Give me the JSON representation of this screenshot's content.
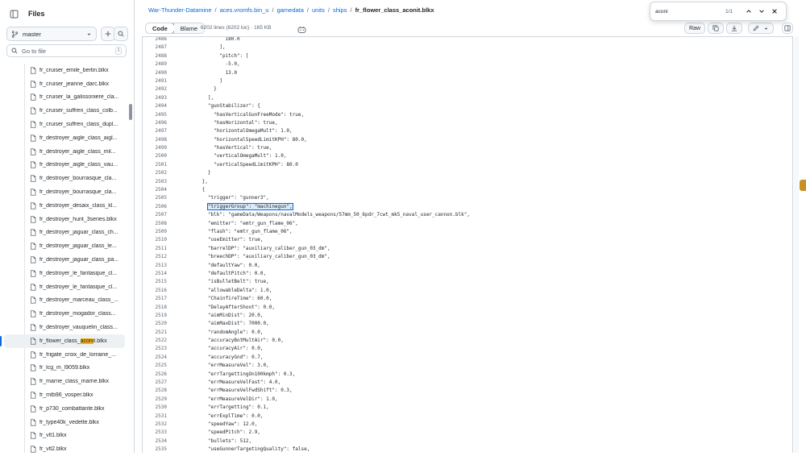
{
  "sidebar": {
    "title": "Files",
    "branch": "master",
    "goto_placeholder": "Go to file",
    "goto_shortcut": "t",
    "items": [
      {
        "label": "fr_cruiser_emile_bertin.blkx"
      },
      {
        "label": "fr_cruiser_jeanne_darc.blkx"
      },
      {
        "label": "fr_cruiser_la_galissoniere_cla..."
      },
      {
        "label": "fr_cruiser_suffren_class_colb..."
      },
      {
        "label": "fr_cruiser_suffren_class_dupl..."
      },
      {
        "label": "fr_destroyer_aigle_class_aigl..."
      },
      {
        "label": "fr_destroyer_aigle_class_mil..."
      },
      {
        "label": "fr_destroyer_aigle_class_vau..."
      },
      {
        "label": "fr_destroyer_bourrasque_cla..."
      },
      {
        "label": "fr_destroyer_bourrasque_cla..."
      },
      {
        "label": "fr_destroyer_desaix_class_kl..."
      },
      {
        "label": "fr_destroyer_hunt_3series.blkx"
      },
      {
        "label": "fr_destroyer_jaguar_class_ch..."
      },
      {
        "label": "fr_destroyer_jaguar_class_le..."
      },
      {
        "label": "fr_destroyer_jaguar_class_pa..."
      },
      {
        "label": "fr_destroyer_le_fantasque_cl..."
      },
      {
        "label": "fr_destroyer_le_fantasque_cl..."
      },
      {
        "label": "fr_destroyer_marceau_class_..."
      },
      {
        "label": "fr_destroyer_mogador_class..."
      },
      {
        "label": "fr_destroyer_vauquelin_class..."
      },
      {
        "label": "fr_flower_class_aconit.blkx",
        "pre": "fr_flower_class_",
        "hl": "aconi",
        "post": "t.blkx",
        "selected": true
      },
      {
        "label": "fr_frigate_croix_de_lorraine_..."
      },
      {
        "label": "fr_lcg_m_l9059.blkx"
      },
      {
        "label": "fr_marne_class_marne.blkx"
      },
      {
        "label": "fr_mtb96_vosper.blkx"
      },
      {
        "label": "fr_p730_combattante.blkx"
      },
      {
        "label": "fr_type40k_vedette.blkx"
      },
      {
        "label": "fr_vlt1.blkx"
      },
      {
        "label": "fr_vlt2.blkx"
      }
    ]
  },
  "breadcrumbs": {
    "repo": "War-Thunder-Datamine",
    "parts": [
      "aces.vromfs.bin_u",
      "gamedata",
      "units",
      "ships"
    ],
    "current": "fr_flower_class_aconit.blkx"
  },
  "toolbar": {
    "code_label": "Code",
    "blame_label": "Blame",
    "meta": "6202 lines (6202 loc) · 165 KB",
    "raw_label": "Raw"
  },
  "find": {
    "query": "aconi",
    "count": "1/1"
  },
  "code": {
    "lines": [
      {
        "n": "2486",
        "t": "              180.0"
      },
      {
        "n": "2487",
        "t": "            ],"
      },
      {
        "n": "2488",
        "t": "            \"pitch\": ["
      },
      {
        "n": "2489",
        "t": "              -5.0,"
      },
      {
        "n": "2490",
        "t": "              13.0"
      },
      {
        "n": "2491",
        "t": "            ]"
      },
      {
        "n": "2492",
        "t": "          }"
      },
      {
        "n": "2493",
        "t": "        ],"
      },
      {
        "n": "2494",
        "t": "        \"gunStabilizer\": {"
      },
      {
        "n": "2495",
        "t": "          \"hasVerticalGunFreeMode\": true,"
      },
      {
        "n": "2496",
        "t": "          \"hasHorizontal\": true,"
      },
      {
        "n": "2497",
        "t": "          \"horizontalOmegaMult\": 1.0,"
      },
      {
        "n": "2498",
        "t": "          \"horizontalSpeedLimitKPH\": 80.0,"
      },
      {
        "n": "2499",
        "t": "          \"hasVertical\": true,"
      },
      {
        "n": "2500",
        "t": "          \"verticalOmegaMult\": 1.0,"
      },
      {
        "n": "2501",
        "t": "          \"verticalSpeedLimitKPH\": 80.0"
      },
      {
        "n": "2502",
        "t": "        }"
      },
      {
        "n": "2503",
        "t": "      },"
      },
      {
        "n": "2504",
        "t": "      {"
      },
      {
        "n": "2505",
        "t": "        \"trigger\": \"gunner3\","
      },
      {
        "n": "2506",
        "t": "        \"triggerGroup\": \"machinegun\",",
        "cur": true
      },
      {
        "n": "2507",
        "t": "        \"blk\": \"gameData/Weapons/navalModels_weapons/57mm_50_6pdr_7cwt_mk5_naval_user_cannon.blk\","
      },
      {
        "n": "2508",
        "t": "        \"emitter\": \"emtr_gun_flame_06\","
      },
      {
        "n": "2509",
        "t": "        \"flash\": \"emtr_gun_flame_06\","
      },
      {
        "n": "2510",
        "t": "        \"useEmitter\": true,"
      },
      {
        "n": "2511",
        "t": "        \"barrelDP\": \"auxiliary_caliber_gun_03_dm\","
      },
      {
        "n": "2512",
        "t": "        \"breechDP\": \"auxiliary_caliber_gun_03_dm\","
      },
      {
        "n": "2513",
        "t": "        \"defaultYaw\": 0.0,"
      },
      {
        "n": "2514",
        "t": "        \"defaultPitch\": 0.0,"
      },
      {
        "n": "2515",
        "t": "        \"isBulletBelt\": true,"
      },
      {
        "n": "2516",
        "t": "        \"allowableDelta\": 1.0,"
      },
      {
        "n": "2517",
        "t": "        \"ChainfireTime\": 60.0,"
      },
      {
        "n": "2518",
        "t": "        \"DelayAfterShoot\": 0.0,"
      },
      {
        "n": "2519",
        "t": "        \"aimMinDist\": 20.0,"
      },
      {
        "n": "2520",
        "t": "        \"aimMaxDist\": 7000.0,"
      },
      {
        "n": "2521",
        "t": "        \"randomAngle\": 0.0,"
      },
      {
        "n": "2522",
        "t": "        \"accuracyBotMultAir\": 0.0,"
      },
      {
        "n": "2523",
        "t": "        \"accuracyAir\": 0.0,"
      },
      {
        "n": "2524",
        "t": "        \"accuracyGnd\": 0.7,"
      },
      {
        "n": "2525",
        "t": "        \"errMeasureVel\": 3.0,"
      },
      {
        "n": "2526",
        "t": "        \"errTargettingOn100kmph\": 0.3,"
      },
      {
        "n": "2527",
        "t": "        \"errMeasureVelFast\": 4.0,"
      },
      {
        "n": "2528",
        "t": "        \"errMeasureVelFwdShift\": 0.3,"
      },
      {
        "n": "2529",
        "t": "        \"errMeasureVelDir\": 1.0,"
      },
      {
        "n": "2530",
        "t": "        \"errTargetting\": 0.1,"
      },
      {
        "n": "2531",
        "t": "        \"errExplTime\": 0.0,"
      },
      {
        "n": "2532",
        "t": "        \"speedYaw\": 12.0,"
      },
      {
        "n": "2533",
        "t": "        \"speedPitch\": 2.9,"
      },
      {
        "n": "2534",
        "t": "        \"bullets\": 512,"
      },
      {
        "n": "2535",
        "t": "        \"useGunnerTargetingQuality\": false,"
      }
    ]
  }
}
